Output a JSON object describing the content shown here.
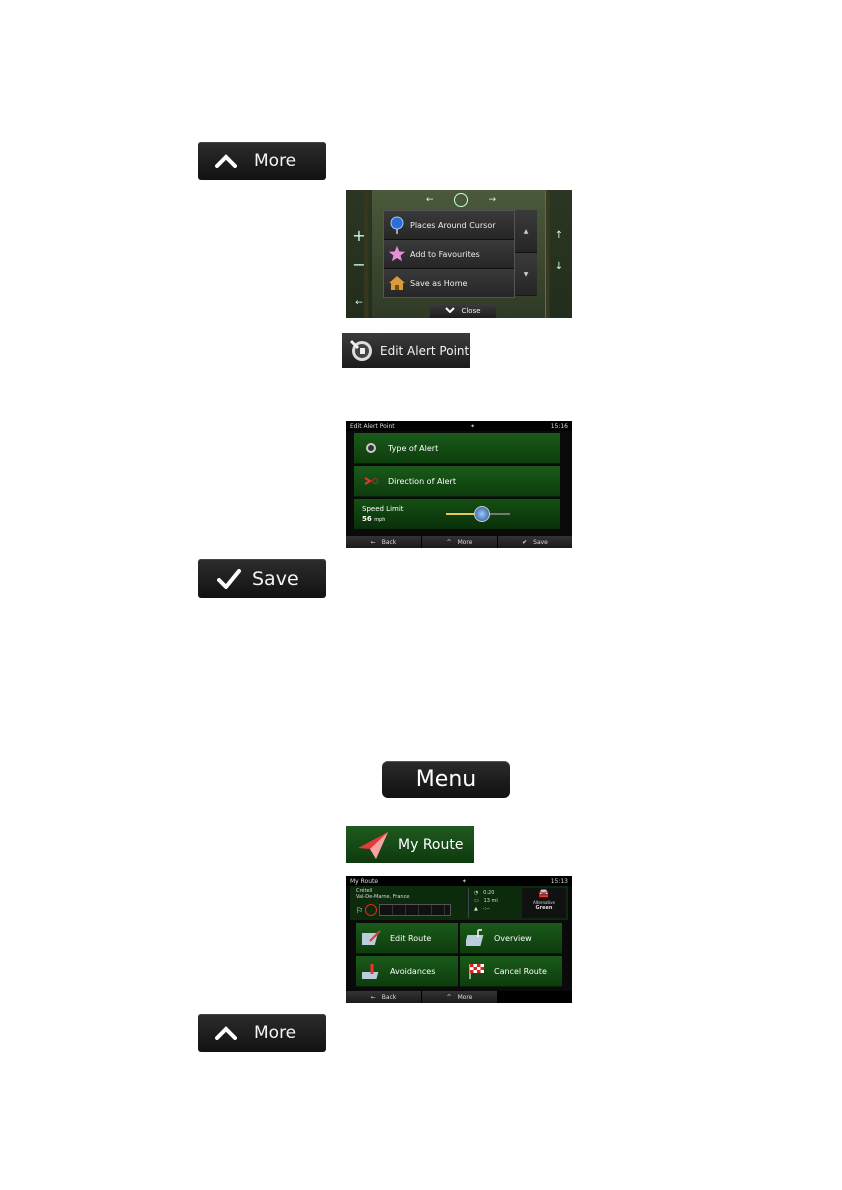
{
  "top_more_button": {
    "label": "More"
  },
  "map_popup": {
    "items": [
      {
        "label": "Places Around Cursor",
        "icon": "globe-pin-icon"
      },
      {
        "label": "Add to Favourites",
        "icon": "star-icon"
      },
      {
        "label": "Save as Home",
        "icon": "house-icon"
      }
    ],
    "close_label": "Close"
  },
  "edit_alert_button": {
    "label": "Edit Alert Point"
  },
  "edit_alert_screen": {
    "title": "Edit Alert Point",
    "time": "15:16",
    "rows": [
      {
        "label": "Type of Alert",
        "icon": "alert-type-icon"
      },
      {
        "label": "Direction of Alert",
        "icon": "direction-icon"
      }
    ],
    "speed_label": "Speed Limit",
    "speed_value": "56",
    "speed_unit": "mph",
    "speed_fraction": 0.55,
    "bottom": {
      "back": "Back",
      "more": "More",
      "save": "Save"
    }
  },
  "save_button": {
    "label": "Save"
  },
  "menu_button": {
    "label": "Menu"
  },
  "my_route_button": {
    "label": "My Route"
  },
  "my_route_screen": {
    "title": "My Route",
    "time": "15:13",
    "origin_line1": "Créteil",
    "origin_line2": "Val-De-Marne, France",
    "eta_time": "0:20",
    "distance": "13 mi",
    "remaining": "-:--",
    "alt_label": "Alternative",
    "alt_value": "Green",
    "tiles": [
      {
        "label": "Edit Route",
        "icon": "edit-route-icon"
      },
      {
        "label": "Overview",
        "icon": "overview-icon"
      },
      {
        "label": "Avoidances",
        "icon": "avoidances-icon"
      },
      {
        "label": "Cancel Route",
        "icon": "checkered-flag-icon"
      }
    ],
    "bottom": {
      "back": "Back",
      "more": "More"
    }
  },
  "bottom_more_button": {
    "label": "More"
  },
  "colors": {
    "accent_green": "#1a5a1a",
    "button_dark": "#1a1a1a",
    "slider_yellow": "#e8c85a"
  }
}
